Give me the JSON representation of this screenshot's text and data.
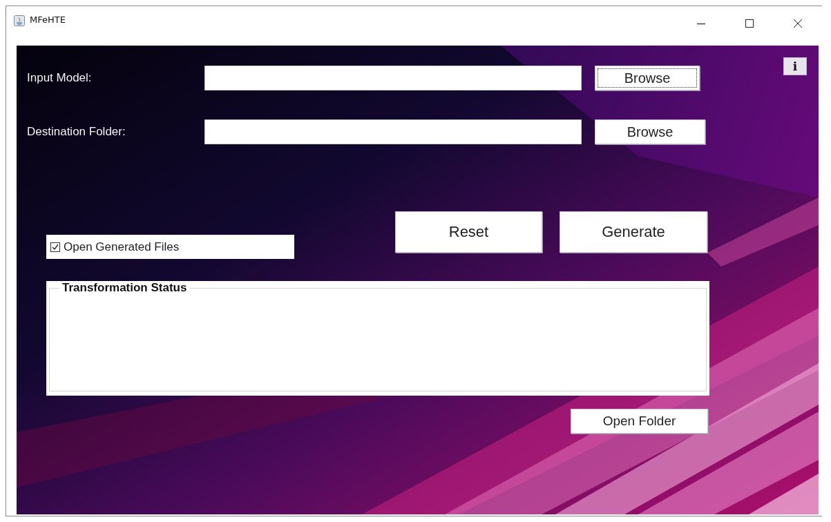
{
  "window": {
    "title": "MFeHTE"
  },
  "info_button": {
    "label": "i"
  },
  "rows": [
    {
      "label": "Input Model:",
      "button": {
        "label": "Browse",
        "focused": true
      }
    },
    {
      "label": "Destination Folder:",
      "button": {
        "label": "Browse",
        "focused": false
      }
    }
  ],
  "open_generated_files": {
    "label": "Open Generated Files",
    "checked": true
  },
  "actions": [
    {
      "label": "Reset"
    },
    {
      "label": "Generate"
    }
  ],
  "status_panel": {
    "title": "Transformation Status"
  },
  "open_folder_button": {
    "label": "Open Folder"
  }
}
